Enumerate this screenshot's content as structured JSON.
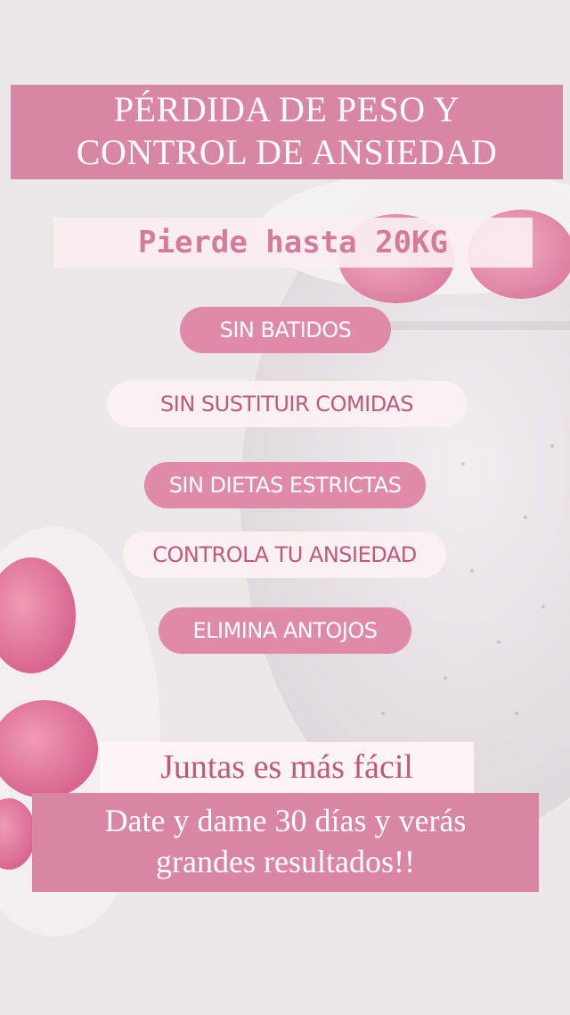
{
  "title": {
    "line1": "PÉRDIDA DE PESO Y",
    "line2": "CONTROL DE ANSIEDAD"
  },
  "subtitle": "Pierde hasta 20KG",
  "benefits": [
    "SIN BATIDOS",
    "SIN SUSTITUIR COMIDAS",
    "SIN DIETAS ESTRICTAS",
    "CONTROLA TU ANSIEDAD",
    "ELIMINA ANTOJOS"
  ],
  "tagline": "Juntas es más fácil",
  "closing": {
    "line1": "Date y dame 30 días y verás",
    "line2": "grandes resultados!!"
  },
  "colors": {
    "accent_pink": "#d986a5",
    "text_pink": "#c0587e",
    "background": "#ede8ea"
  }
}
